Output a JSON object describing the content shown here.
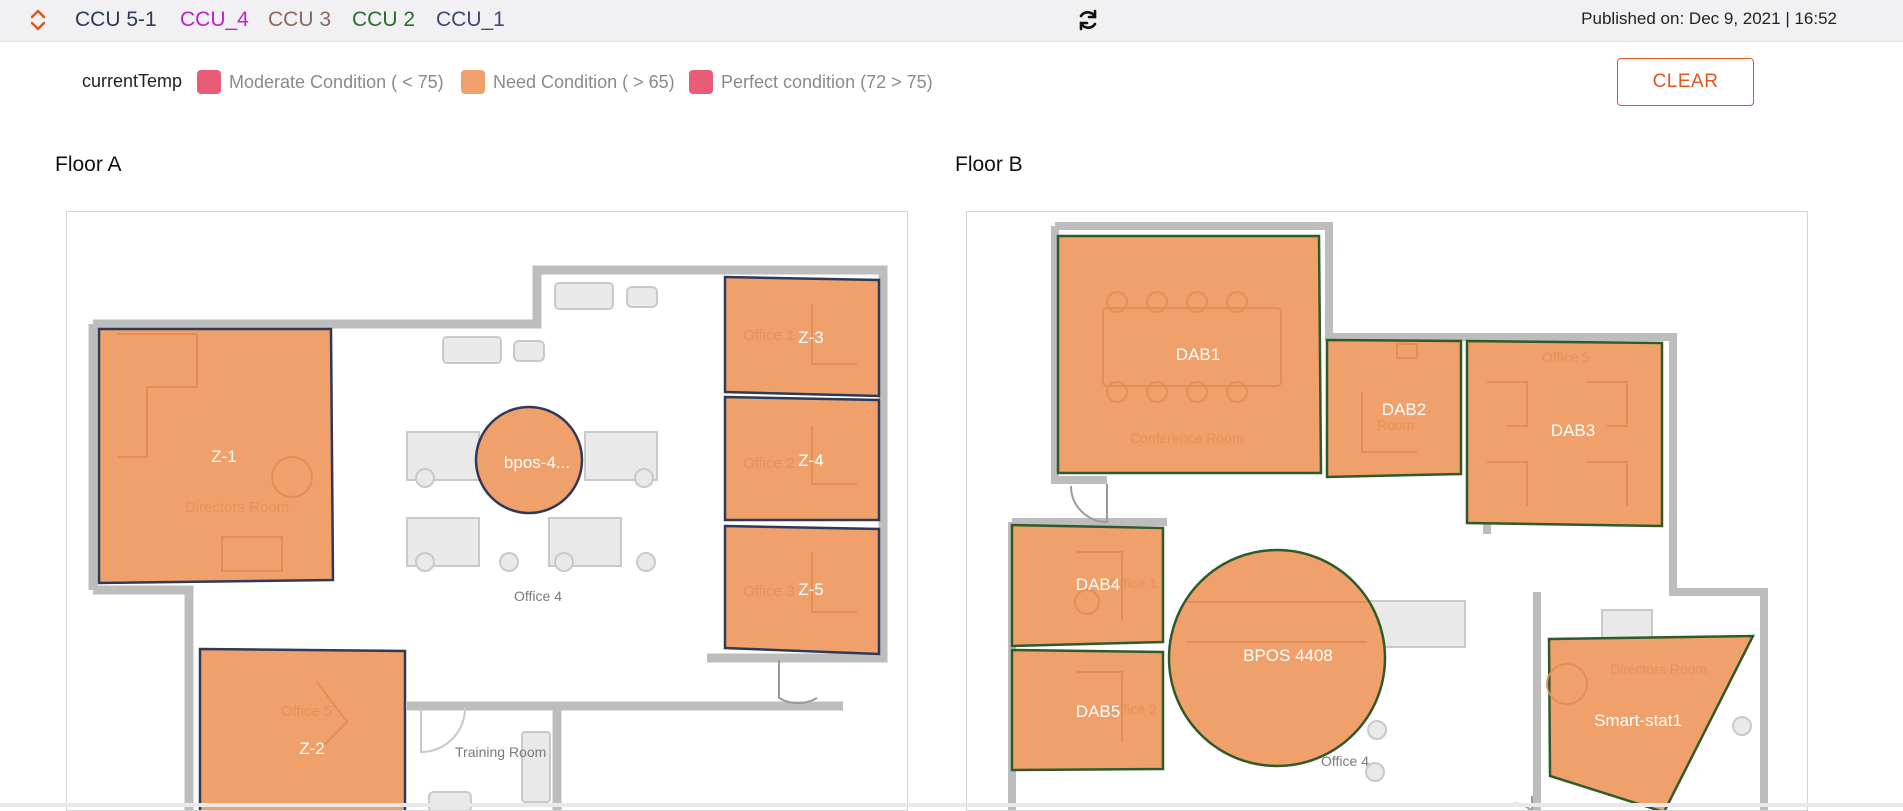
{
  "header": {
    "tabs": [
      {
        "label": "CCU 5-1",
        "color": "#2e3a59"
      },
      {
        "label": "CCU_4",
        "color": "#c21ecf"
      },
      {
        "label": "CCU 3",
        "color": "#8a6a5e"
      },
      {
        "label": "CCU 2",
        "color": "#2f6b2f"
      },
      {
        "label": "CCU_1",
        "color": "#3e4b6e"
      }
    ],
    "published": "Published on: Dec 9, 2021 | 16:52"
  },
  "legend": {
    "title": "currentTemp",
    "items": [
      {
        "label": "Moderate Condition ( < 75)",
        "color": "#e85d75"
      },
      {
        "label": "Need Condition ( > 65)",
        "color": "#f0a06a"
      },
      {
        "label": "Perfect condition (72 > 75)",
        "color": "#e85d75"
      }
    ]
  },
  "clear_label": "CLEAR",
  "floors": {
    "a": {
      "title": "Floor A",
      "room_texts": [
        "Office 1",
        "Office 2",
        "Office 3",
        "Directors Room",
        "Office 4",
        "Office 5",
        "Training Room"
      ],
      "zones": [
        {
          "label": "Z-1"
        },
        {
          "label": "bpos-4..."
        },
        {
          "label": "Z-3"
        },
        {
          "label": "Z-4"
        },
        {
          "label": "Z-5"
        },
        {
          "label": "Z-2"
        }
      ]
    },
    "b": {
      "title": "Floor B",
      "room_texts": [
        "Conference Room",
        "Room",
        "Office 5",
        "Office 1",
        "Office 2",
        "Office 4",
        "Directors Room"
      ],
      "zones": [
        {
          "label": "DAB1"
        },
        {
          "label": "DAB2"
        },
        {
          "label": "DAB3"
        },
        {
          "label": "DAB4"
        },
        {
          "label": "DAB5"
        },
        {
          "label": "BPOS 4408"
        },
        {
          "label": "Smart-stat1"
        }
      ]
    }
  },
  "colors": {
    "accent": "#e0561f",
    "zone_fill": "#f0a06a",
    "floor_a_border": "#2e3a59",
    "floor_b_border": "#2f5a2a",
    "wall": "#b9b9b9"
  },
  "icons": {
    "sort": "sort-arrows-icon",
    "refresh": "refresh-icon"
  }
}
